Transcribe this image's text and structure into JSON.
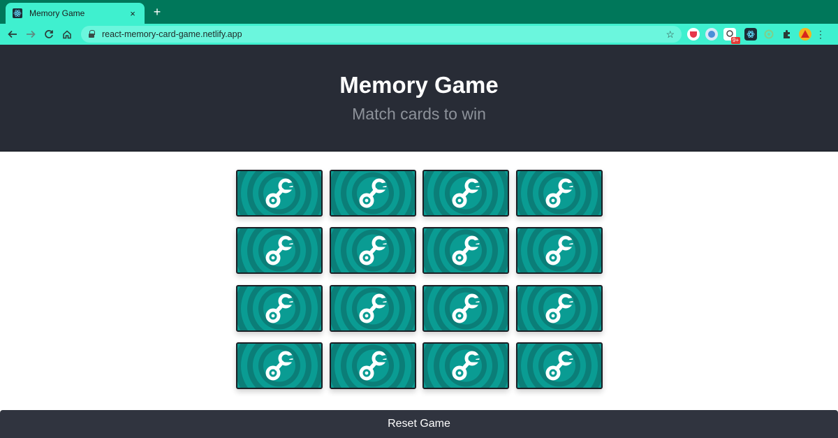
{
  "browser": {
    "tab_title": "Memory Game",
    "tab_close": "×",
    "new_tab": "+",
    "url": "react-memory-card-game.netlify.app",
    "ext_badge": "9+"
  },
  "header": {
    "title": "Memory Game",
    "subtitle": "Match cards to win"
  },
  "cards": [
    {
      "state": "face-down",
      "icon": "wrench-icon"
    },
    {
      "state": "face-down",
      "icon": "wrench-icon"
    },
    {
      "state": "face-down",
      "icon": "wrench-icon"
    },
    {
      "state": "face-down",
      "icon": "wrench-icon"
    },
    {
      "state": "face-down",
      "icon": "wrench-icon"
    },
    {
      "state": "face-down",
      "icon": "wrench-icon"
    },
    {
      "state": "face-down",
      "icon": "wrench-icon"
    },
    {
      "state": "face-down",
      "icon": "wrench-icon"
    },
    {
      "state": "face-down",
      "icon": "wrench-icon"
    },
    {
      "state": "face-down",
      "icon": "wrench-icon"
    },
    {
      "state": "face-down",
      "icon": "wrench-icon"
    },
    {
      "state": "face-down",
      "icon": "wrench-icon"
    },
    {
      "state": "face-down",
      "icon": "wrench-icon"
    },
    {
      "state": "face-down",
      "icon": "wrench-icon"
    },
    {
      "state": "face-down",
      "icon": "wrench-icon"
    },
    {
      "state": "face-down",
      "icon": "wrench-icon"
    }
  ],
  "reset_label": "Reset Game",
  "colors": {
    "browser_frame": "#00775a",
    "browser_toolbar": "#3ff0cf",
    "header_bg": "#282c36",
    "subtitle": "#8d929a",
    "card_teal": "#0a9c93",
    "card_ring": "#0b7e78",
    "reset_bg": "#30343f"
  }
}
